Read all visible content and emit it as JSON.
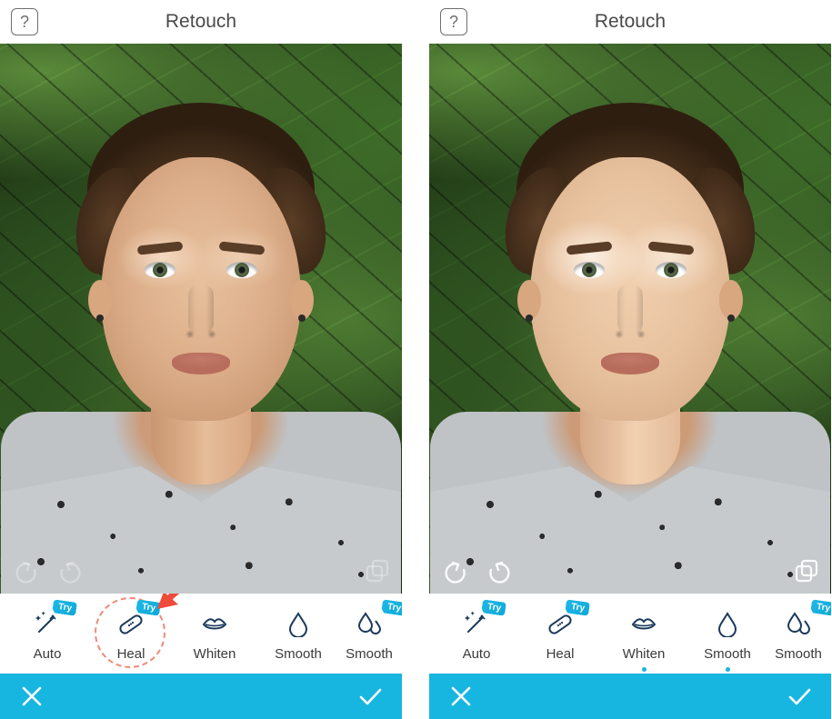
{
  "left": {
    "header": {
      "title": "Retouch",
      "help_symbol": "?"
    },
    "canvas_controls_active": false,
    "tools": [
      {
        "name": "auto",
        "label": "Auto",
        "try": true,
        "icon": "wand-icon",
        "highlighted": false,
        "active": false
      },
      {
        "name": "heal",
        "label": "Heal",
        "try": true,
        "icon": "bandaid-icon",
        "highlighted": true,
        "active": false
      },
      {
        "name": "whiten",
        "label": "Whiten",
        "try": false,
        "icon": "lips-icon",
        "highlighted": false,
        "active": false
      },
      {
        "name": "smooth",
        "label": "Smooth",
        "try": false,
        "icon": "drop-icon",
        "highlighted": false,
        "active": false
      },
      {
        "name": "smooth2",
        "label": "Smooth",
        "try": true,
        "icon": "drops-icon",
        "highlighted": false,
        "active": false,
        "partial": true
      }
    ],
    "annotation": {
      "arrow_color": "#f04a3a"
    },
    "footer": {
      "cancel": "✕",
      "confirm": "✓",
      "accent": "#17b6e0"
    }
  },
  "right": {
    "header": {
      "title": "Retouch",
      "help_symbol": "?"
    },
    "canvas_controls_active": true,
    "tools": [
      {
        "name": "auto",
        "label": "Auto",
        "try": true,
        "icon": "wand-icon",
        "highlighted": false,
        "active": false
      },
      {
        "name": "heal",
        "label": "Heal",
        "try": true,
        "icon": "bandaid-icon",
        "highlighted": false,
        "active": false
      },
      {
        "name": "whiten",
        "label": "Whiten",
        "try": false,
        "icon": "lips-icon",
        "highlighted": false,
        "active": true
      },
      {
        "name": "smooth",
        "label": "Smooth",
        "try": false,
        "icon": "drop-icon",
        "highlighted": false,
        "active": true
      },
      {
        "name": "smooth2",
        "label": "Smooth",
        "try": true,
        "icon": "drops-icon",
        "highlighted": false,
        "active": false,
        "partial": true
      }
    ],
    "footer": {
      "cancel": "✕",
      "confirm": "✓",
      "accent": "#17b6e0"
    }
  },
  "icons": {
    "undo": "↶",
    "redo": "↷",
    "compare": "⧉"
  }
}
